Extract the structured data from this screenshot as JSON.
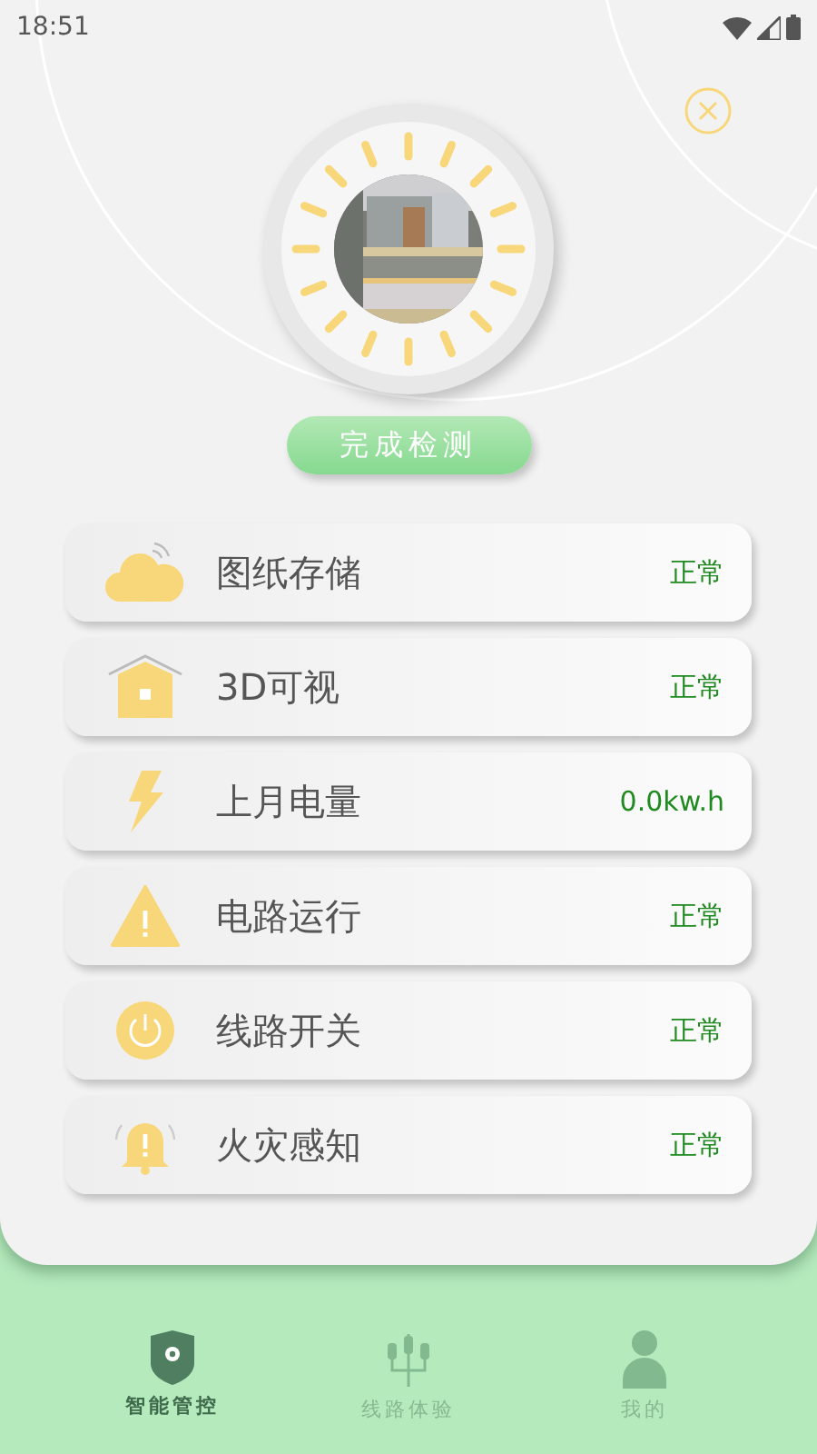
{
  "status_bar": {
    "time": "18:51"
  },
  "detect_button": {
    "label": "完成检测"
  },
  "items": [
    {
      "kind": "cloud",
      "label": "图纸存储",
      "status": "正常"
    },
    {
      "kind": "house",
      "label": "3D可视",
      "status": "正常"
    },
    {
      "kind": "bolt",
      "label": "上月电量",
      "status": "0.0kw.h"
    },
    {
      "kind": "warning",
      "label": "电路运行",
      "status": "正常"
    },
    {
      "kind": "power",
      "label": "线路开关",
      "status": "正常"
    },
    {
      "kind": "bell",
      "label": "火灾感知",
      "status": "正常"
    }
  ],
  "nav": [
    {
      "kind": "shield",
      "label": "智能管控",
      "selected": true
    },
    {
      "kind": "circuit",
      "label": "线路体验",
      "selected": false
    },
    {
      "kind": "person",
      "label": "我的",
      "selected": false
    }
  ]
}
